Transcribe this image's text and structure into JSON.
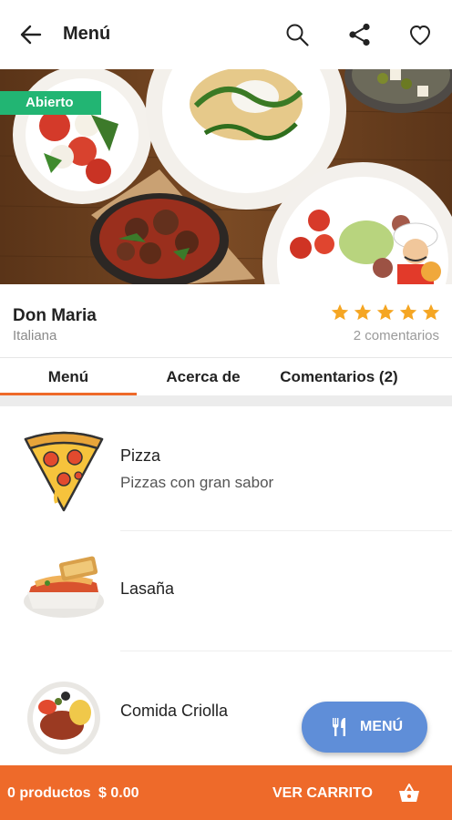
{
  "header": {
    "title": "Menú",
    "back_icon": "arrow-left-icon",
    "actions": [
      {
        "name": "search-icon"
      },
      {
        "name": "share-icon"
      },
      {
        "name": "heart-icon"
      }
    ]
  },
  "hero": {
    "status_badge": "Abierto",
    "status_color": "#22b573"
  },
  "restaurant": {
    "name": "Don Maria",
    "cuisine": "Italiana",
    "rating": 5,
    "rating_max": 5,
    "reviews": "2 comentarios",
    "star_color": "#f5a623"
  },
  "tabs": [
    {
      "label": "Menú",
      "active": true
    },
    {
      "label": "Acerca de",
      "active": false
    },
    {
      "label": "Comentarios (2)",
      "active": false
    }
  ],
  "menu_items": [
    {
      "name": "Pizza",
      "description": "Pizzas con gran sabor",
      "icon": "pizza-slice-icon"
    },
    {
      "name": "Lasaña",
      "description": "",
      "icon": "lasagna-dish-icon"
    },
    {
      "name": "Comida Criolla",
      "description": "",
      "icon": "creole-plate-icon"
    }
  ],
  "fab": {
    "label": "MENÚ",
    "icon": "fork-knife-icon",
    "color": "#5f8ed8"
  },
  "cart_bar": {
    "products": "0 productos",
    "total": "$ 0.00",
    "view_cart": "VER CARRITO",
    "icon": "basket-icon",
    "color": "#ee6a2a"
  }
}
